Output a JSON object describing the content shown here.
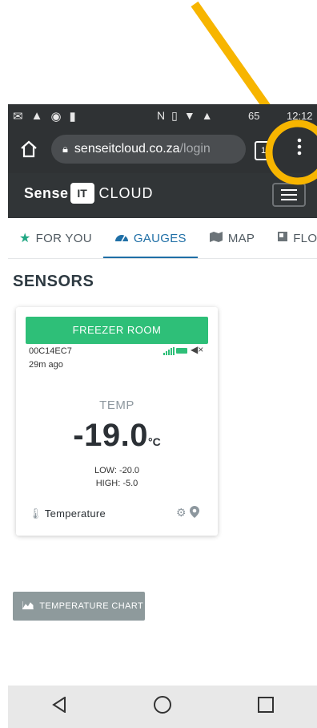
{
  "status_bar": {
    "left_icons": [
      "✉",
      "▲",
      "◉",
      "▮"
    ],
    "right_icons": [
      "N",
      "▯",
      "▼",
      "▲"
    ],
    "battery": "65",
    "time": "12:12"
  },
  "browser": {
    "url_host": "senseitcloud.co.za",
    "url_path": "/login",
    "tab_count": "1"
  },
  "site": {
    "logo_sense": "Sense",
    "logo_it": "IT",
    "logo_cloud": "CLOUD"
  },
  "nav_tabs": [
    {
      "label": "FOR YOU",
      "icon": "star-icon"
    },
    {
      "label": "GAUGES",
      "icon": "gauge-icon"
    },
    {
      "label": "MAP",
      "icon": "map-icon"
    },
    {
      "label": "FLOOR",
      "icon": "floorplan-icon"
    }
  ],
  "sensors": {
    "title": "SENSORS",
    "card": {
      "name": "FREEZER ROOM",
      "device_id": "00C14EC7",
      "last_seen": "29m ago",
      "reading_label": "TEMP",
      "value": "-19.0",
      "unit": "°C",
      "low": "LOW: -20.0",
      "high": "HIGH: -5.0",
      "sensor_type": "Temperature"
    }
  },
  "temperature_chart_button": "TEMPERATURE CHART",
  "colors": {
    "accent_green": "#2ebf78",
    "active_tab_blue": "#1f6fa6",
    "annotation_yellow": "#f7b500"
  }
}
